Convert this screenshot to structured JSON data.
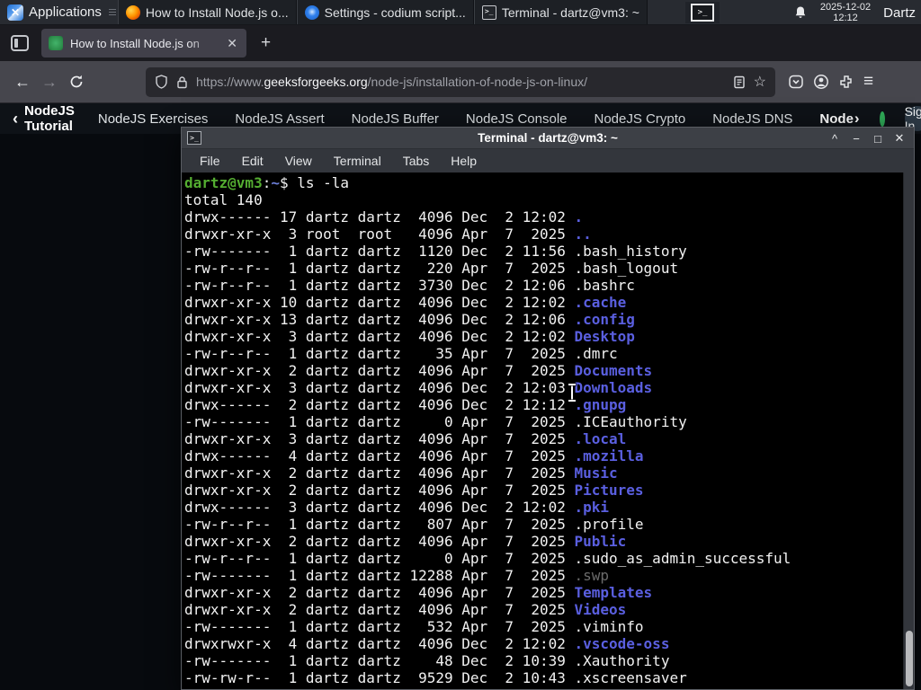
{
  "icons": {
    "back": "←",
    "forward": "→",
    "star": "☆",
    "hamburger": "≡",
    "new_tab": "+",
    "tab_close": "✕",
    "win_minimize": "—",
    "win_maximize": "□",
    "win_close": "✕",
    "term_shade": "^",
    "term_minimize": "−",
    "term_maximize": "□",
    "term_close": "✕",
    "nav_back_chevron": "‹",
    "nav_more_chevron": "›",
    "launcher_glyph": ">_",
    "title_icon_glyph": ">_"
  },
  "panel": {
    "applications_label": "Applications",
    "window_buttons": [
      {
        "label": "How to Install Node.js o...",
        "icon": "firefox"
      },
      {
        "label": "Settings - codium script...",
        "icon": "codium"
      },
      {
        "label": "Terminal - dartz@vm3: ~",
        "icon": "terminal"
      }
    ],
    "clock_date": "2025-12-02",
    "clock_time": "12:12",
    "user_label": "Dartz"
  },
  "browser": {
    "tab_title": "How to Install Node.js on",
    "url_prefix": "https://www.",
    "url_domain": "geeksforgeeks.org",
    "url_path": "/node-js/installation-of-node-js-on-linux/"
  },
  "site_nav": {
    "back_label": "NodeJS Tutorial",
    "items": [
      "NodeJS Exercises",
      "NodeJS Assert",
      "NodeJS Buffer",
      "NodeJS Console",
      "NodeJS Crypto",
      "NodeJS DNS"
    ],
    "more_label": "Node",
    "sign_in_label": "Sign In"
  },
  "terminal": {
    "title": "Terminal - dartz@vm3: ~",
    "menu_items": [
      "File",
      "Edit",
      "View",
      "Terminal",
      "Tabs",
      "Help"
    ],
    "prompt": {
      "user_host": "dartz@vm3",
      "colon": ":",
      "path": "~",
      "rest": "$ ls -la"
    },
    "total_line": "total 140",
    "ls_rows": [
      {
        "pre": "drwx------ 17 dartz dartz  4096 Dec  2 12:02 ",
        "name": ".",
        "type": "dir"
      },
      {
        "pre": "drwxr-xr-x  3 root  root   4096 Apr  7  2025 ",
        "name": "..",
        "type": "dir"
      },
      {
        "pre": "-rw-------  1 dartz dartz  1120 Dec  2 11:56 ",
        "name": ".bash_history",
        "type": "file"
      },
      {
        "pre": "-rw-r--r--  1 dartz dartz   220 Apr  7  2025 ",
        "name": ".bash_logout",
        "type": "file"
      },
      {
        "pre": "-rw-r--r--  1 dartz dartz  3730 Dec  2 12:06 ",
        "name": ".bashrc",
        "type": "file"
      },
      {
        "pre": "drwxr-xr-x 10 dartz dartz  4096 Dec  2 12:02 ",
        "name": ".cache",
        "type": "dir"
      },
      {
        "pre": "drwxr-xr-x 13 dartz dartz  4096 Dec  2 12:06 ",
        "name": ".config",
        "type": "dir"
      },
      {
        "pre": "drwxr-xr-x  3 dartz dartz  4096 Dec  2 12:02 ",
        "name": "Desktop",
        "type": "dir"
      },
      {
        "pre": "-rw-r--r--  1 dartz dartz    35 Apr  7  2025 ",
        "name": ".dmrc",
        "type": "file"
      },
      {
        "pre": "drwxr-xr-x  2 dartz dartz  4096 Apr  7  2025 ",
        "name": "Documents",
        "type": "dir"
      },
      {
        "pre": "drwxr-xr-x  3 dartz dartz  4096 Dec  2 12:03 ",
        "name": "Downloads",
        "type": "dir"
      },
      {
        "pre": "drwx------  2 dartz dartz  4096 Dec  2 12:12 ",
        "name": ".gnupg",
        "type": "dir"
      },
      {
        "pre": "-rw-------  1 dartz dartz     0 Apr  7  2025 ",
        "name": ".ICEauthority",
        "type": "file"
      },
      {
        "pre": "drwxr-xr-x  3 dartz dartz  4096 Apr  7  2025 ",
        "name": ".local",
        "type": "dir"
      },
      {
        "pre": "drwx------  4 dartz dartz  4096 Apr  7  2025 ",
        "name": ".mozilla",
        "type": "dir"
      },
      {
        "pre": "drwxr-xr-x  2 dartz dartz  4096 Apr  7  2025 ",
        "name": "Music",
        "type": "dir"
      },
      {
        "pre": "drwxr-xr-x  2 dartz dartz  4096 Apr  7  2025 ",
        "name": "Pictures",
        "type": "dir"
      },
      {
        "pre": "drwx------  3 dartz dartz  4096 Dec  2 12:02 ",
        "name": ".pki",
        "type": "dir"
      },
      {
        "pre": "-rw-r--r--  1 dartz dartz   807 Apr  7  2025 ",
        "name": ".profile",
        "type": "file"
      },
      {
        "pre": "drwxr-xr-x  2 dartz dartz  4096 Apr  7  2025 ",
        "name": "Public",
        "type": "dir"
      },
      {
        "pre": "-rw-r--r--  1 dartz dartz     0 Apr  7  2025 ",
        "name": ".sudo_as_admin_successful",
        "type": "file"
      },
      {
        "pre": "-rw-------  1 dartz dartz 12288 Apr  7  2025 ",
        "name": ".swp",
        "type": "dim"
      },
      {
        "pre": "drwxr-xr-x  2 dartz dartz  4096 Apr  7  2025 ",
        "name": "Templates",
        "type": "dir"
      },
      {
        "pre": "drwxr-xr-x  2 dartz dartz  4096 Apr  7  2025 ",
        "name": "Videos",
        "type": "dir"
      },
      {
        "pre": "-rw-------  1 dartz dartz   532 Apr  7  2025 ",
        "name": ".viminfo",
        "type": "file"
      },
      {
        "pre": "drwxrwxr-x  4 dartz dartz  4096 Dec  2 12:02 ",
        "name": ".vscode-oss",
        "type": "dir"
      },
      {
        "pre": "-rw-------  1 dartz dartz    48 Dec  2 10:39 ",
        "name": ".Xauthority",
        "type": "file"
      },
      {
        "pre": "-rw-rw-r--  1 dartz dartz  9529 Dec  2 10:43 ",
        "name": ".xscreensaver",
        "type": "file"
      }
    ]
  },
  "colors": {
    "panel_bg": "#282b31",
    "browser_toolbar_bg": "#46464d",
    "tabbar_bg": "#1b1b20",
    "terminal_bg": "#000000",
    "terminal_fg": "#f2f2f2",
    "dir_blue": "#5a5fe0",
    "prompt_green": "#54ad31",
    "gfg_green": "#2fab58",
    "sitenav_bg": "#0e1217"
  }
}
